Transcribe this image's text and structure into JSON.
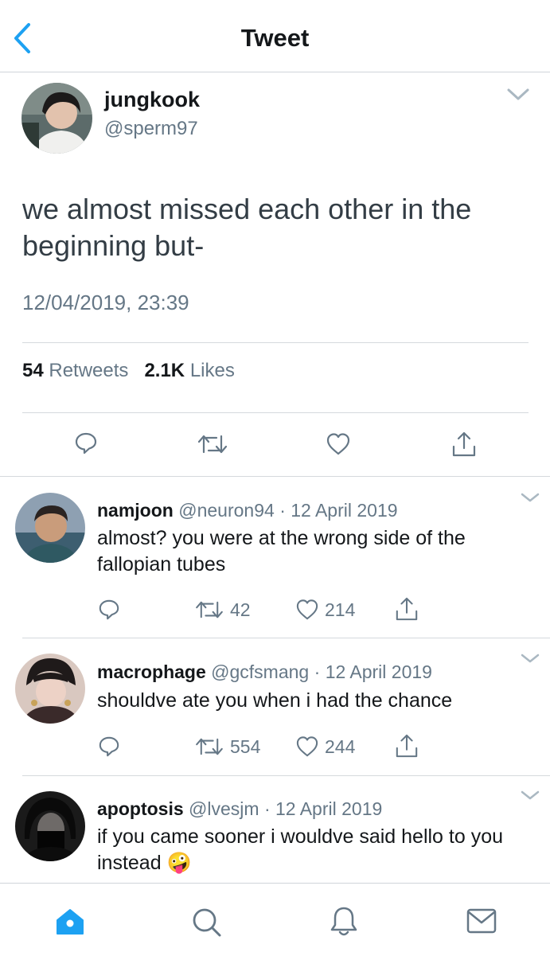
{
  "header": {
    "title": "Tweet"
  },
  "tweet": {
    "name": "jungkook",
    "handle": "@sperm97",
    "text": "we almost missed each other in the beginning but-",
    "timestamp": "12/04/2019, 23:39",
    "retweet_count": "54",
    "retweet_label": "Retweets",
    "like_count": "2.1K",
    "like_label": "Likes"
  },
  "replies": [
    {
      "name": "namjoon",
      "handle": "@neuron94",
      "date": "12 April 2019",
      "text": "almost? you were at the wrong side of the fallopian tubes",
      "retweets": "42",
      "likes": "214"
    },
    {
      "name": "macrophage",
      "handle": "@gcfsmang",
      "date": "12 April 2019",
      "text": "shouldve ate you when i had the chance",
      "retweets": "554",
      "likes": "244"
    },
    {
      "name": "apoptosis",
      "handle": "@lvesjm",
      "date": "12 April 2019",
      "text": "if you came sooner i wouldve said hello to you instead",
      "emoji": "🤪",
      "retweets": "",
      "likes": ""
    }
  ],
  "separator": "·",
  "icons": [
    "back-icon",
    "chevron-down-icon",
    "reply-icon",
    "retweet-icon",
    "like-icon",
    "share-icon",
    "home-icon",
    "search-icon",
    "notifications-icon",
    "messages-icon"
  ],
  "colors": {
    "accent": "#1da1f2",
    "text": "#14171a",
    "secondary": "#657786",
    "divider": "#d5d9dd"
  }
}
